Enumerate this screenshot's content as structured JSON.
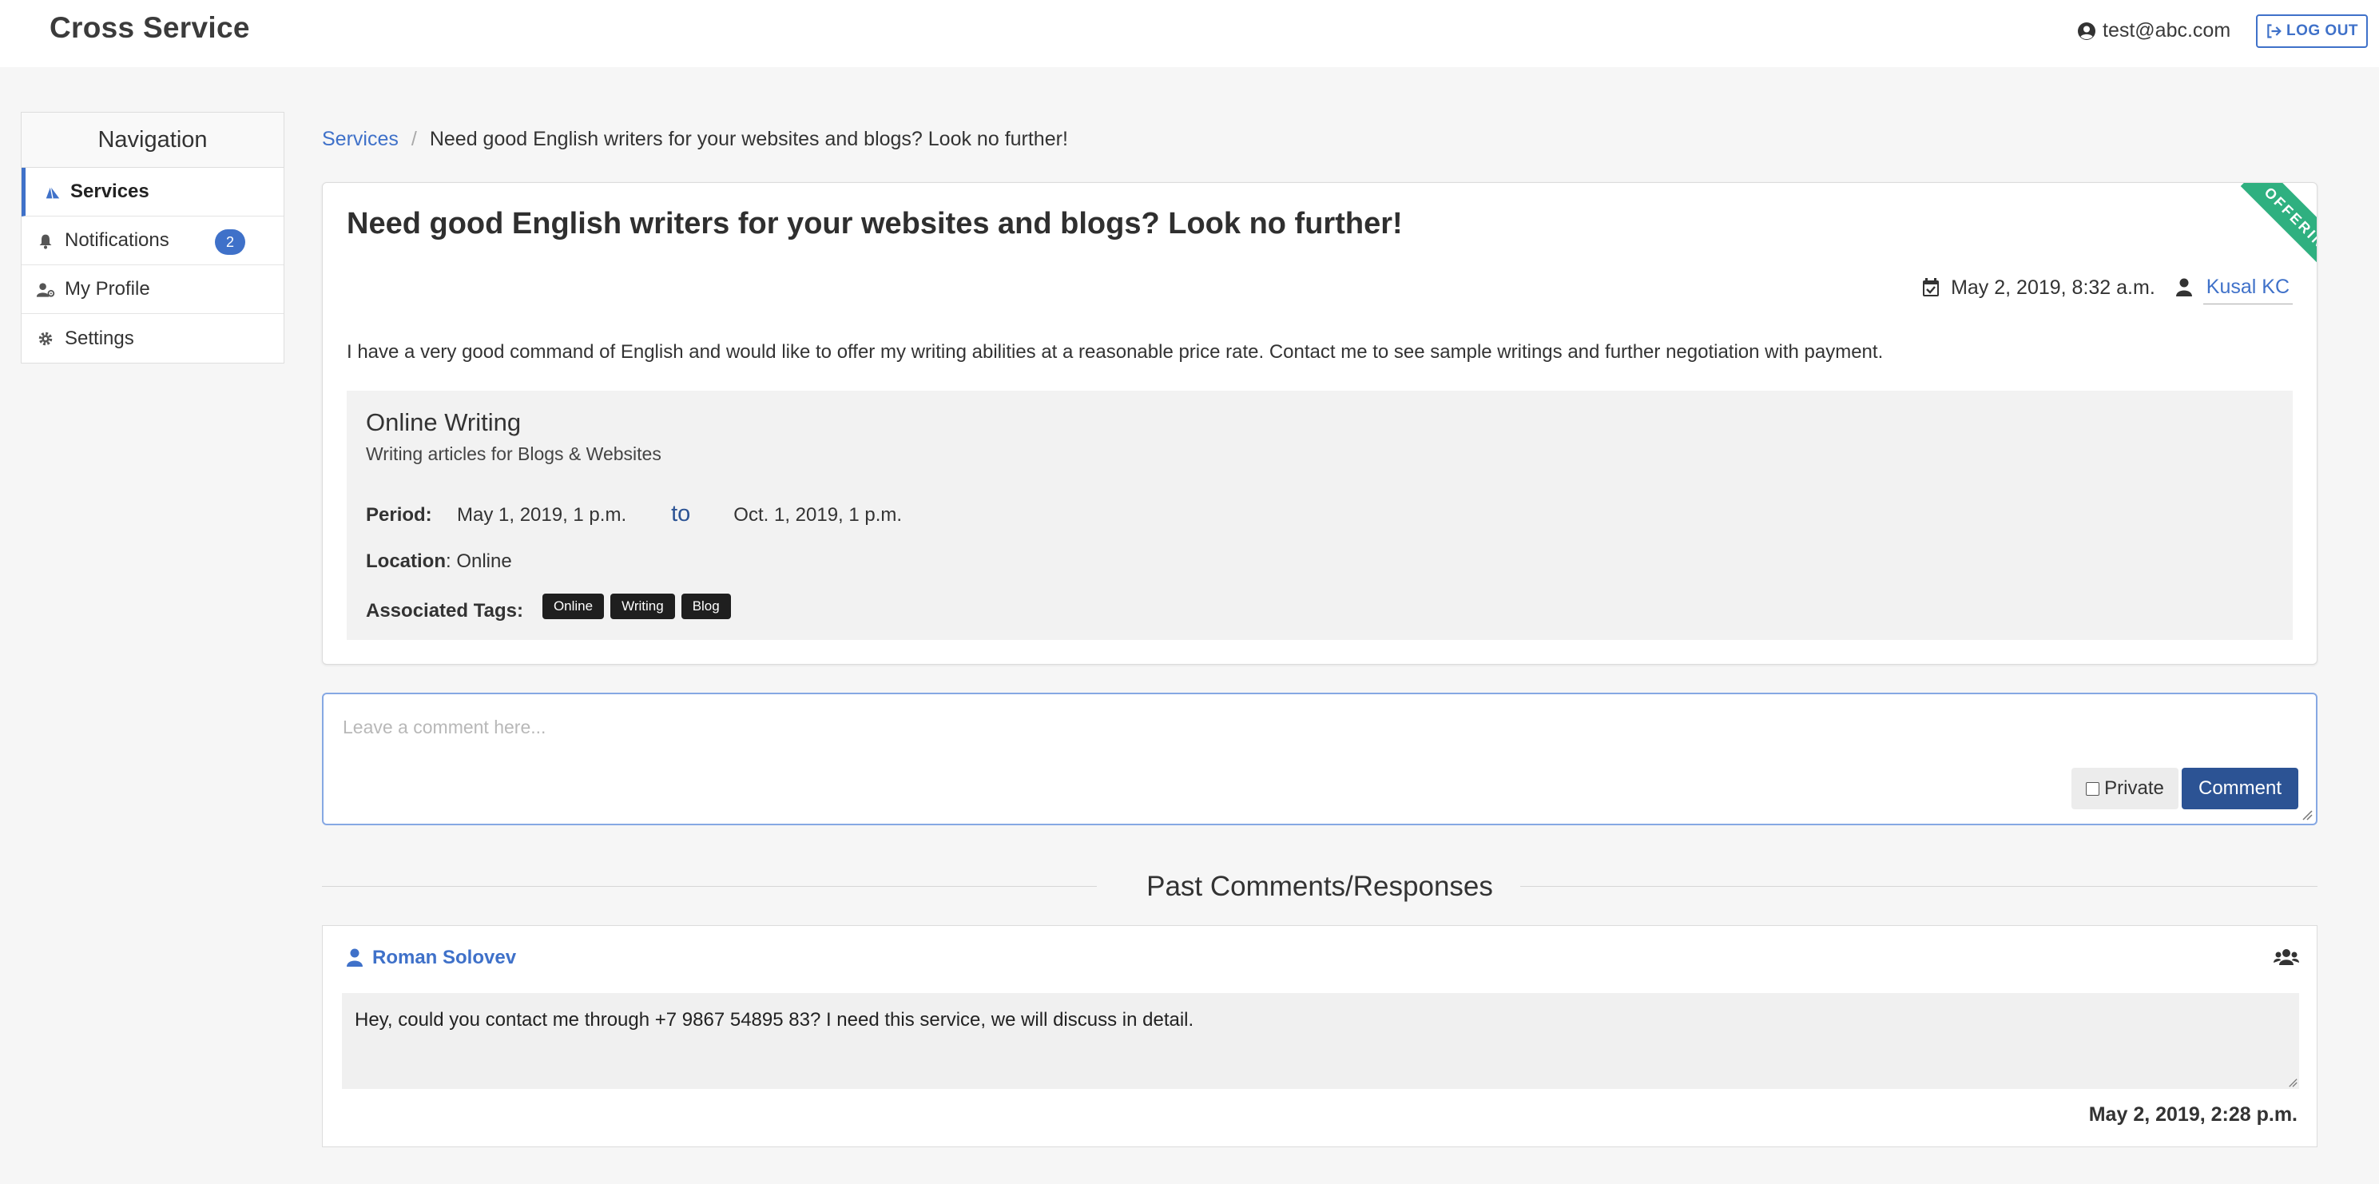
{
  "app": {
    "brand": "Cross Service"
  },
  "header": {
    "user_email": "test@abc.com",
    "logout_label": "LOG OUT"
  },
  "nav": {
    "title": "Navigation",
    "items": [
      {
        "label": "Services",
        "icon": "services-icon",
        "active": true
      },
      {
        "label": "Notifications",
        "icon": "bell-icon",
        "badge": "2"
      },
      {
        "label": "My Profile",
        "icon": "user-cog-icon"
      },
      {
        "label": "Settings",
        "icon": "gear-icon"
      }
    ]
  },
  "breadcrumb": {
    "root": "Services",
    "separator": "/",
    "current": "Need good English writers for your websites and blogs? Look no further!"
  },
  "post": {
    "title": "Need good English writers for your websites and blogs? Look no further!",
    "ribbon": "OFFERING",
    "date": "May 2, 2019, 8:32 a.m.",
    "author": "Kusal KC",
    "description": "I have a very good command of English and would like to offer my writing abilities at a reasonable price rate. Contact me to see sample writings and further negotiation with payment.",
    "service": {
      "title": "Online Writing",
      "subtitle": "Writing articles for Blogs & Websites",
      "period_label": "Period:",
      "period_start": "May 1, 2019, 1 p.m.",
      "period_to": "to",
      "period_end": "Oct. 1, 2019, 1 p.m.",
      "location_label": "Location",
      "location_value": ": Online",
      "tags_label": "Associated Tags:",
      "tags": [
        "Online",
        "Writing",
        "Blog"
      ]
    }
  },
  "comment_form": {
    "placeholder": "Leave a comment here...",
    "private_label": "Private",
    "submit_label": "Comment"
  },
  "past_comments": {
    "heading": "Past Comments/Responses",
    "items": [
      {
        "user": "Roman Solovev",
        "text": "Hey, could you contact me through +7 9867 54895 83? I need this service, we will discuss in detail.",
        "date": "May 2, 2019, 2:28 p.m."
      }
    ]
  },
  "colors": {
    "accent": "#3f71c9",
    "button": "#2c5394",
    "ribbon": "#2fb080",
    "tag": "#1f1f1f"
  }
}
